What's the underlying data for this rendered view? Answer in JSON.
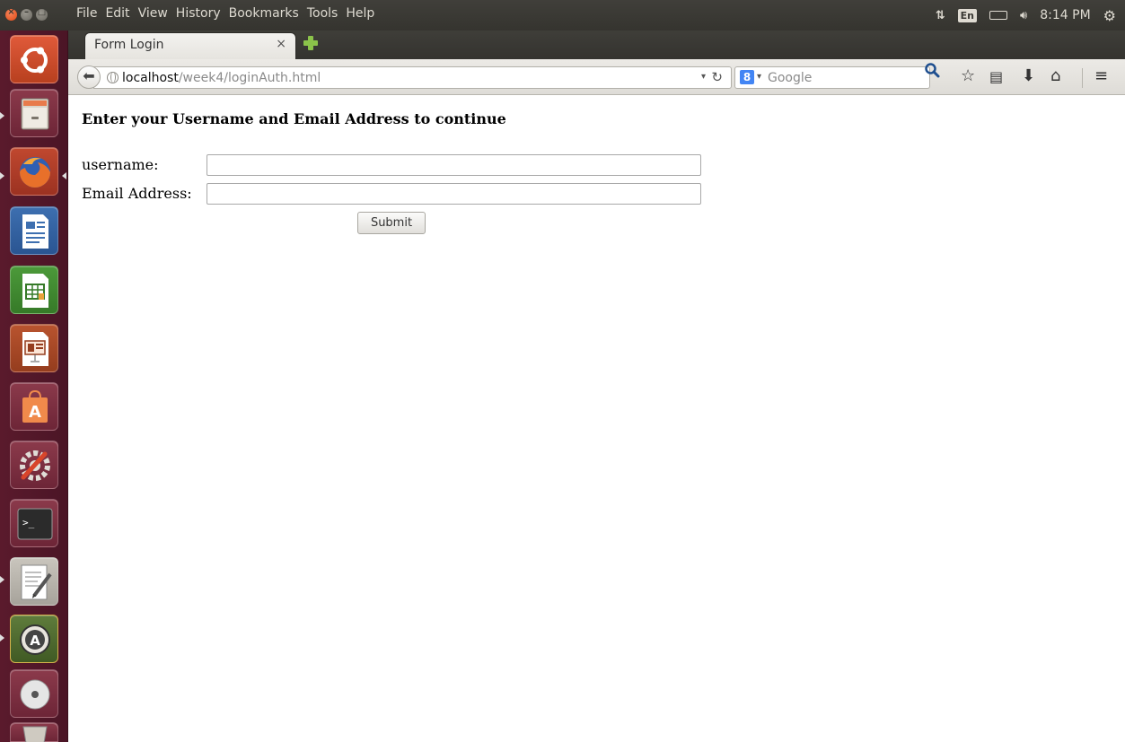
{
  "top_panel": {
    "menu": [
      "File",
      "Edit",
      "View",
      "History",
      "Bookmarks",
      "Tools",
      "Help"
    ],
    "indicators": {
      "network_icon": "network-updown-icon",
      "keyboard_lang": "En",
      "battery_icon": "battery-icon",
      "volume_icon": "volume-icon",
      "clock": "8:14 PM",
      "settings_icon": "session-gear-icon"
    }
  },
  "tab": {
    "title": "Form Login",
    "close_glyph": "×"
  },
  "navbar": {
    "url_host": "localhost",
    "url_path": "/week4/loginAuth.html",
    "search_placeholder": "Google",
    "search_engine_glyph": "8",
    "dropdown_glyph": "▾"
  },
  "page": {
    "heading": "Enter your Username and Email Address to continue",
    "username_label": "username:",
    "username_value": "",
    "email_label": "Email Address:",
    "email_value": "",
    "submit_label": "Submit"
  },
  "launcher": [
    {
      "name": "ubuntu-dash",
      "icon": "ubuntu-logo-icon"
    },
    {
      "name": "files",
      "icon": "file-cabinet-icon"
    },
    {
      "name": "firefox",
      "icon": "firefox-icon"
    },
    {
      "name": "libreoffice-writer",
      "icon": "writer-document-icon"
    },
    {
      "name": "libreoffice-calc",
      "icon": "calc-spreadsheet-icon"
    },
    {
      "name": "libreoffice-impress",
      "icon": "impress-presentation-icon"
    },
    {
      "name": "software-center",
      "icon": "shopping-bag-icon"
    },
    {
      "name": "system-settings",
      "icon": "settings-wrench-icon"
    },
    {
      "name": "terminal",
      "icon": "terminal-icon"
    },
    {
      "name": "text-editor",
      "icon": "text-editor-icon"
    },
    {
      "name": "software-updater",
      "icon": "software-updater-icon"
    },
    {
      "name": "dvd",
      "icon": "disc-icon"
    },
    {
      "name": "trash",
      "icon": "trash-icon"
    }
  ]
}
